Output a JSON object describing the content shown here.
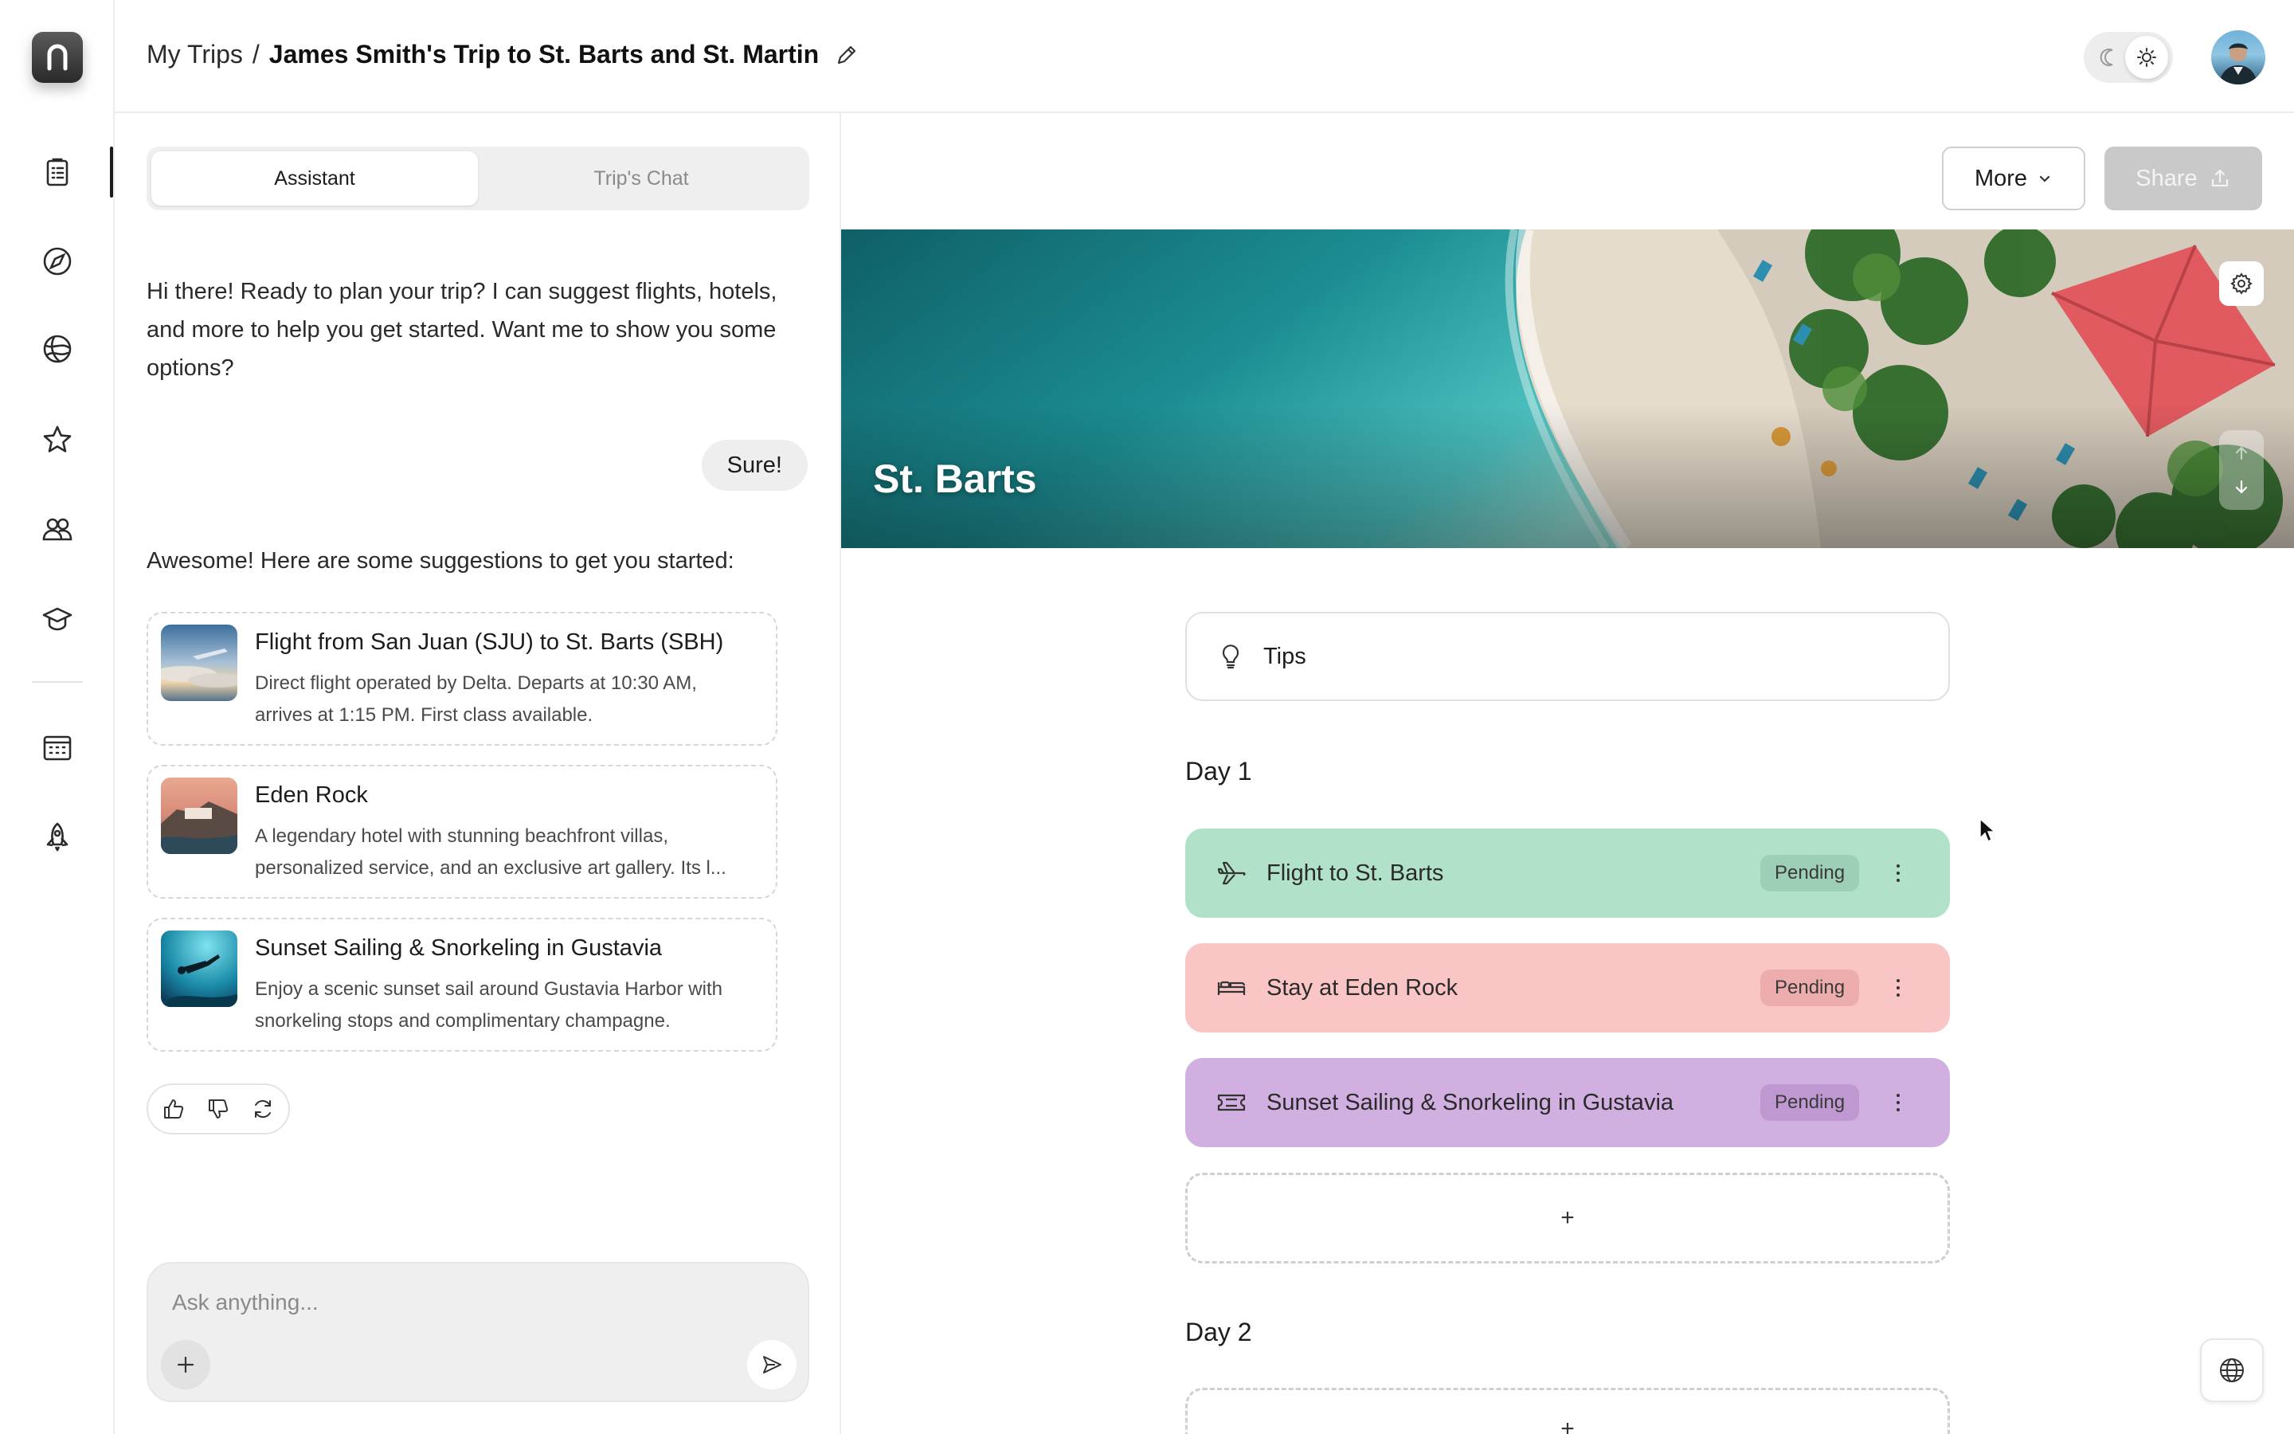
{
  "header": {
    "breadcrumb_root": "My Trips",
    "breadcrumb_sep": "/",
    "trip_title": "James Smith's Trip to St. Barts and  St. Martin"
  },
  "sidebar": {
    "items": [
      {
        "icon": "clipboard-list-icon"
      },
      {
        "icon": "compass-icon"
      },
      {
        "icon": "globe-icon"
      },
      {
        "icon": "star-icon"
      },
      {
        "icon": "users-icon"
      },
      {
        "icon": "graduation-cap-icon"
      },
      {
        "icon": "calendar-icon"
      },
      {
        "icon": "rocket-icon"
      }
    ]
  },
  "chat": {
    "tabs": [
      {
        "label": "Assistant",
        "active": true
      },
      {
        "label": "Trip's Chat",
        "active": false
      }
    ],
    "messages": {
      "assistant_intro": "Hi there! Ready to plan your trip? I can suggest flights, hotels, and more to help you get started. Want me to show you some options?",
      "user_reply": "Sure!",
      "assistant_followup": "Awesome! Here are some suggestions to get you started:"
    },
    "suggestions": [
      {
        "title": "Flight from San Juan (SJU) to St. Barts (SBH)",
        "desc_line1": "Direct flight operated by Delta. Departs at 10:30 AM,",
        "desc_line2": "arrives at 1:15 PM. First class available."
      },
      {
        "title": "Eden Rock",
        "desc_line1": "A legendary hotel with stunning beachfront villas,",
        "desc_line2": "personalized service, and an exclusive art gallery. Its l..."
      },
      {
        "title": "Sunset Sailing & Snorkeling in Gustavia",
        "desc_line1": "Enjoy a scenic sunset sail around Gustavia Harbor with",
        "desc_line2": "snorkeling stops and complimentary champagne."
      }
    ],
    "composer": {
      "placeholder": "Ask anything..."
    }
  },
  "toolbar": {
    "more_label": "More",
    "share_label": "Share"
  },
  "destination": {
    "name": "St. Barts",
    "tips_label": "Tips"
  },
  "days": [
    {
      "label": "Day 1",
      "items": [
        {
          "title": "Flight to St. Barts",
          "status": "Pending",
          "icon": "plane-icon",
          "color": "#b1e2c9"
        },
        {
          "title": "Stay at Eden Rock",
          "status": "Pending",
          "icon": "bed-icon",
          "color": "#fac5c5"
        },
        {
          "title": "Sunset Sailing & Snorkeling in Gustavia",
          "status": "Pending",
          "icon": "ticket-icon",
          "color": "#d1afe0"
        }
      ],
      "add_label": "+"
    },
    {
      "label": "Day 2",
      "add_label": "+"
    }
  ],
  "colors": {
    "flight": "#b1e2c9",
    "stay": "#fac5c5",
    "activity": "#d1afe0",
    "share_disabled": "#c9c9c9"
  }
}
